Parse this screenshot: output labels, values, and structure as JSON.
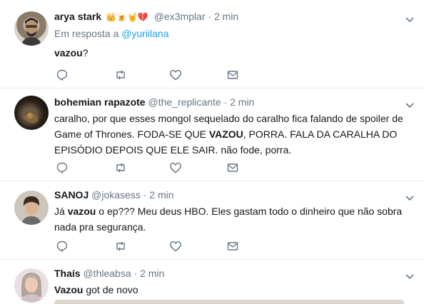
{
  "tweets": [
    {
      "name": "arya stark",
      "emojis": "👑🍺🤘💔",
      "handle": "@ex3mplar",
      "dot": "·",
      "time": "2 min",
      "reply_prefix": "Em resposta a",
      "reply_handle": "@yuriilana",
      "text_bold": "vazou",
      "text_after": "?"
    },
    {
      "name": "bohemian rapazote",
      "handle": "@the_replicante",
      "dot": "·",
      "time": "2 min",
      "text_before": "caralho, por que esses mongol sequelado do caralho fica falando de spoiler de Game of Thrones. FODA-SE QUE ",
      "text_bold": "VAZOU",
      "text_after": ", PORRA. FALA DA CARALHA DO EPISÓDIO DEPOIS QUE ELE SAIR. não fode, porra."
    },
    {
      "name": "SANOJ",
      "handle": "@jokasess",
      "dot": "·",
      "time": "2 min",
      "text_before": "Já ",
      "text_bold": "vazou",
      "text_after": " o ep??? Meu deus HBO. Eles gastam todo o dinheiro que não sobra nada pra segurança."
    },
    {
      "name": "Thaís",
      "handle": "@thleabsa",
      "dot": "·",
      "time": "2 min",
      "text_bold": "Vazou",
      "text_after": " got de novo"
    }
  ],
  "icons": [
    "reply-icon",
    "retweet-icon",
    "like-icon",
    "message-icon",
    "chevron-down-icon"
  ],
  "colors": {
    "link": "#1da1f2",
    "muted": "#657786",
    "text": "#14171a",
    "divider": "#e6ecf0"
  }
}
